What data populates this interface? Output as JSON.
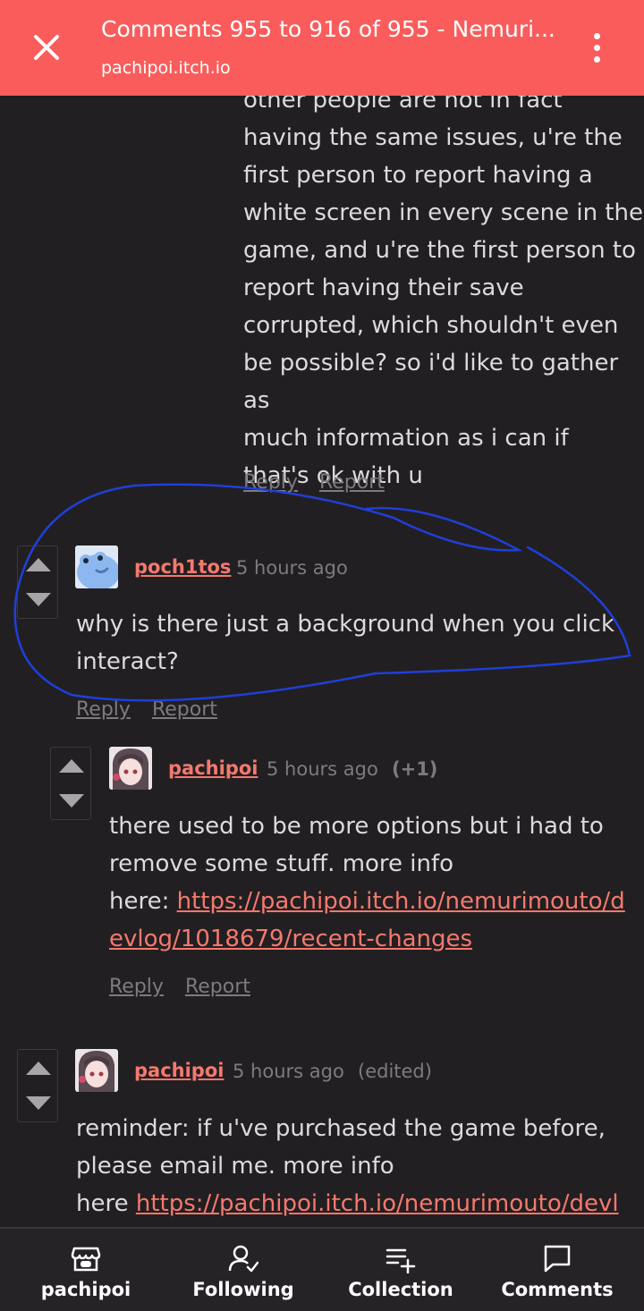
{
  "topbar": {
    "title": "Comments 955 to 916 of 955 - Nemuri...",
    "url": "pachipoi.itch.io"
  },
  "comments": [
    {
      "lines": [
        "other people are not in fact",
        "having the same issues, u're the",
        "first person to report having a",
        "white screen in every scene in the",
        "game, and u're the first person to",
        "report having their save",
        "corrupted, which shouldn't even",
        "be possible? so i'd like to gather as",
        "much information as i can if",
        "that's ok with u"
      ],
      "reply": "Reply",
      "report": "Report"
    },
    {
      "username": "poch1tos",
      "time": "5 hours ago",
      "lines": [
        "why is there just a background when you click",
        "interact?"
      ],
      "reply": "Reply",
      "report": "Report"
    },
    {
      "username": "pachipoi",
      "time": "5 hours ago",
      "badge": "(+1)",
      "line1": "there used to be more options but i had to",
      "line2": "remove some stuff. more info",
      "line3_prefix": "here: ",
      "line3_link": "https://pachipoi.itch.io/nemurimouto/d",
      "line4_link": "evlog/1018679/recent-changes",
      "reply": "Reply",
      "report": "Report"
    },
    {
      "username": "pachipoi",
      "time": "5 hours ago",
      "badge": "(edited)",
      "line1": "reminder: if u've purchased the game before,",
      "line2": "please email me. more info",
      "line3_prefix": "here ",
      "line3_link": "https://pachipoi.itch.io/nemurimouto/devl"
    }
  ],
  "nav": [
    {
      "label": "pachipoi",
      "icon": "store-icon"
    },
    {
      "label": "Following",
      "icon": "user-check-icon"
    },
    {
      "label": "Collection",
      "icon": "playlist-add-icon"
    },
    {
      "label": "Comments",
      "icon": "comment-icon"
    }
  ],
  "colors": {
    "topbar": "#fa5c5c",
    "background": "#221f22",
    "username": "#f4796e",
    "annotation": "#1f3fd8"
  }
}
